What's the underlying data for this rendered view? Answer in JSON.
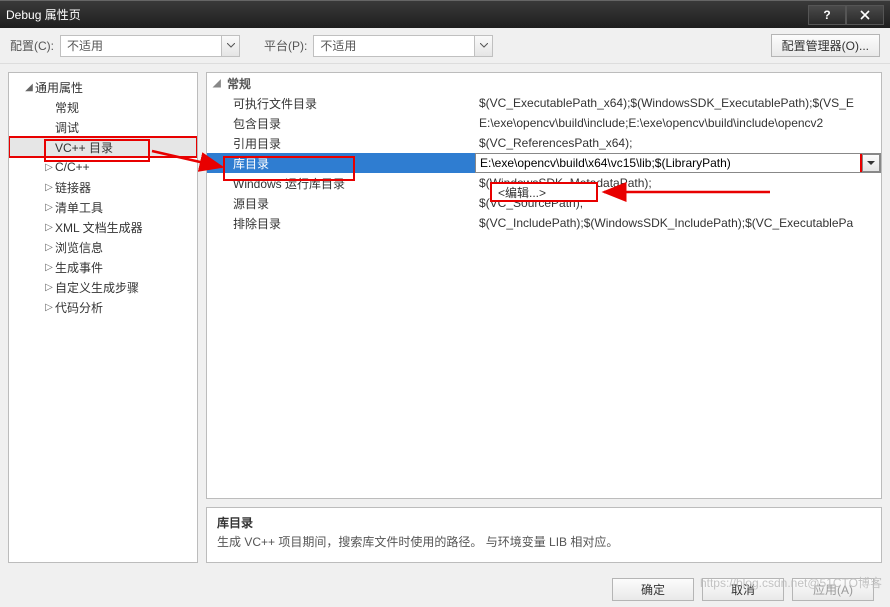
{
  "window": {
    "title": "Debug 属性页"
  },
  "toolbar": {
    "config_label": "配置(C):",
    "config_value": "不适用",
    "platform_label": "平台(P):",
    "platform_value": "不适用",
    "config_manager_label": "配置管理器(O)..."
  },
  "tree": {
    "root": {
      "label": "通用属性",
      "expanded": true
    },
    "items": [
      {
        "label": "常规",
        "expandable": false
      },
      {
        "label": "调试",
        "expandable": false
      },
      {
        "label": "VC++ 目录",
        "expandable": false,
        "selected": true,
        "highlighted": true
      },
      {
        "label": "C/C++",
        "expandable": true
      },
      {
        "label": "链接器",
        "expandable": true
      },
      {
        "label": "清单工具",
        "expandable": true
      },
      {
        "label": "XML 文档生成器",
        "expandable": true
      },
      {
        "label": "浏览信息",
        "expandable": true
      },
      {
        "label": "生成事件",
        "expandable": true
      },
      {
        "label": "自定义生成步骤",
        "expandable": true
      },
      {
        "label": "代码分析",
        "expandable": true
      }
    ]
  },
  "grid": {
    "category": "常规",
    "rows": [
      {
        "label": "可执行文件目录",
        "value": "$(VC_ExecutablePath_x64);$(WindowsSDK_ExecutablePath);$(VS_E"
      },
      {
        "label": "包含目录",
        "value": "E:\\exe\\opencv\\build\\include;E:\\exe\\opencv\\build\\include\\opencv2"
      },
      {
        "label": "引用目录",
        "value": "$(VC_ReferencesPath_x64);"
      },
      {
        "label": "库目录",
        "value": "E:\\exe\\opencv\\build\\x64\\vc15\\lib;$(LibraryPath)",
        "selected": true
      },
      {
        "label": "Windows 运行库目录",
        "value": "$(WindowsSDK_MetadataPath);"
      },
      {
        "label": "源目录",
        "value": "$(VC_SourcePath);"
      },
      {
        "label": "排除目录",
        "value": "$(VC_IncludePath);$(WindowsSDK_IncludePath);$(VC_ExecutablePa"
      }
    ],
    "edit_option": "<编辑...>"
  },
  "description": {
    "title": "库目录",
    "text": "生成 VC++ 项目期间，搜索库文件时使用的路径。 与环境变量 LIB 相对应。"
  },
  "footer": {
    "ok": "确定",
    "cancel": "取消",
    "apply": "应用(A)"
  },
  "watermark": "https://blog.csdn.net@51CTO博客"
}
